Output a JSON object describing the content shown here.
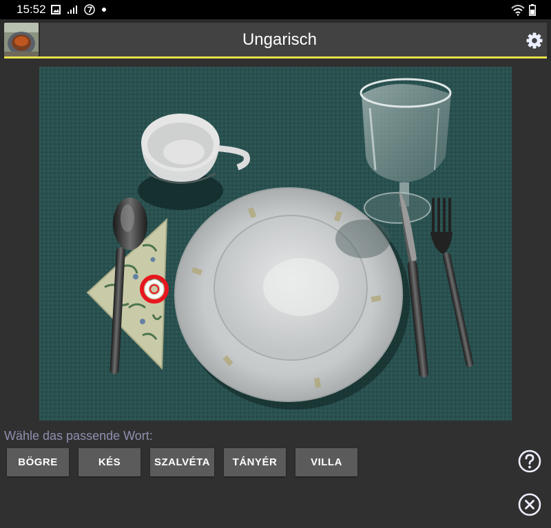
{
  "status_bar": {
    "time": "15:52",
    "icons_left": [
      "image-icon",
      "signal-icon",
      "circled-7-icon",
      "dot-icon"
    ],
    "icons_right": [
      "wifi-icon",
      "battery-icon"
    ]
  },
  "app_bar": {
    "title": "Ungarisch",
    "settings_icon": "gear-icon"
  },
  "quiz": {
    "prompt": "Wähle das passende Wort:",
    "answers": [
      "BÖGRE",
      "KÉS",
      "SZALVÉTA",
      "TÁNYÉR",
      "VILLA"
    ]
  },
  "actions": {
    "help_icon": "question-circle-icon",
    "close_icon": "close-circle-icon"
  },
  "colors": {
    "accent_line": "#e9e24c",
    "marker": "#e8161e",
    "prompt_text": "#8f8fb0"
  }
}
